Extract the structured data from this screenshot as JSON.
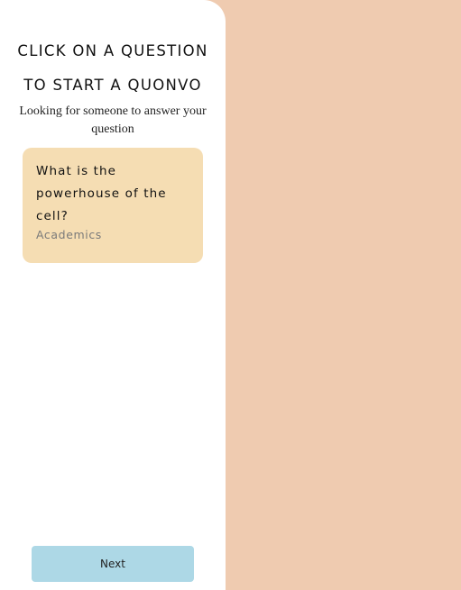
{
  "panel": {
    "title_line1": "CLICK ON A QUESTION",
    "title_line2": "TO START A QUONVO",
    "status": "Looking for someone to answer your question"
  },
  "questions": [
    {
      "text": "What is the powerhouse of the cell?",
      "category": "Academics"
    }
  ],
  "actions": {
    "next_label": "Next"
  },
  "colors": {
    "background": "#EFCBB0",
    "panel": "#FFFFFF",
    "card": "#F5DDB3",
    "button": "#ADD8E6",
    "category_text": "#7A7A7A"
  }
}
